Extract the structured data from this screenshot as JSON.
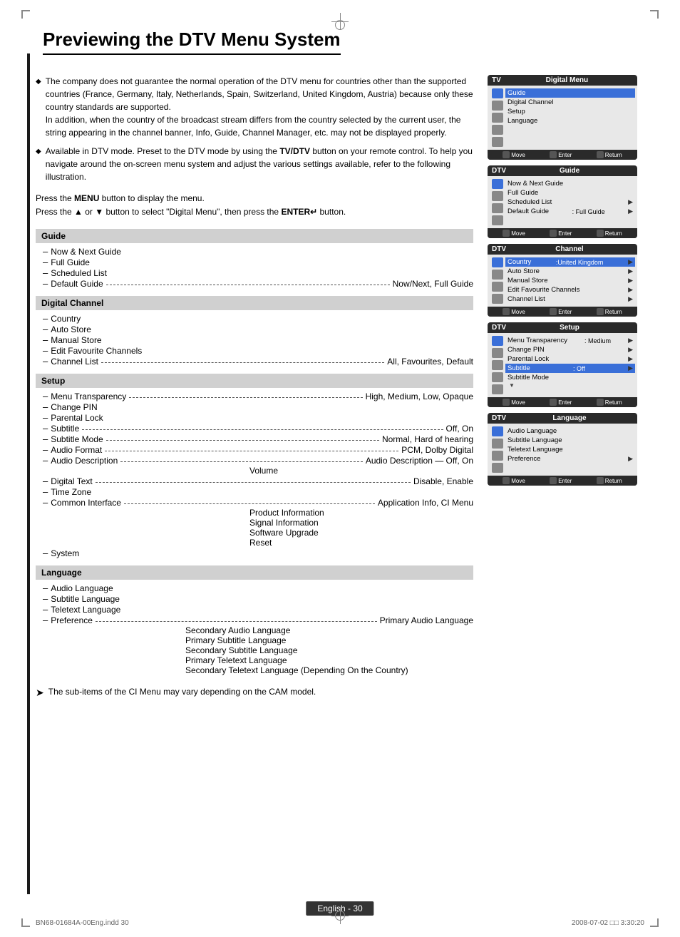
{
  "page": {
    "title": "Previewing the DTV Menu System",
    "crosshair_top": true,
    "crosshair_bottom": true
  },
  "bullets": [
    {
      "id": 1,
      "text": "The company does not guarantee the normal operation of the DTV menu for countries other than the supported countries (France, Germany, Italy, Netherlands, Spain, Switzerland, United Kingdom, Austria) because only these country standards are supported.\nIn addition, when the country of the broadcast stream differs from the country selected by the current user, the string appearing in the channel banner, Info, Guide, Channel Manager, etc. may not be displayed properly."
    },
    {
      "id": 2,
      "text_before": "Available in DTV mode. Preset to the DTV mode by using the ",
      "bold": "TV/DTV",
      "text_after": " button on your remote control. To help you navigate around the on-screen menu system and adjust the various settings available, refer to the following illustration."
    }
  ],
  "press_lines": [
    "Press the MENU button to display the menu.",
    "Press the ▲ or ▼ button to select \"Digital Menu\", then press the ENTER↵ button."
  ],
  "menu_tree": [
    {
      "section": "Guide",
      "items": [
        {
          "label": "Now & Next Guide",
          "annotation": null
        },
        {
          "label": "Full Guide",
          "annotation": null
        },
        {
          "label": "Scheduled List",
          "annotation": null
        },
        {
          "label": "Default Guide",
          "annotation": "Now/Next, Full Guide"
        }
      ]
    },
    {
      "section": "Digital Channel",
      "items": [
        {
          "label": "Country",
          "annotation": null
        },
        {
          "label": "Auto Store",
          "annotation": null
        },
        {
          "label": "Manual Store",
          "annotation": null
        },
        {
          "label": "Edit Favourite Channels",
          "annotation": null
        },
        {
          "label": "Channel List",
          "annotation": "All, Favourites, Default"
        }
      ]
    },
    {
      "section": "Setup",
      "items": [
        {
          "label": "Menu Transparency",
          "annotation": "High, Medium, Low, Opaque"
        },
        {
          "label": "Change PIN",
          "annotation": null
        },
        {
          "label": "Parental Lock",
          "annotation": null
        },
        {
          "label": "Subtitle",
          "annotation": "Off, On"
        },
        {
          "label": "Subtitle Mode",
          "annotation": "Normal, Hard of hearing"
        },
        {
          "label": "Audio Format",
          "annotation": "PCM, Dolby Digital"
        },
        {
          "label": "Audio Description",
          "annotation": "Audio Description — Off, On\nVolume"
        },
        {
          "label": "Digital Text",
          "annotation": "Disable, Enable"
        },
        {
          "label": "Time Zone",
          "annotation": null
        },
        {
          "label": "Common Interface",
          "annotation": "Application Info, CI Menu\nProduct Information\nSignal Information\nSoftware Upgrade\nReset"
        },
        {
          "label": "System",
          "annotation": null
        }
      ]
    },
    {
      "section": "Language",
      "items": [
        {
          "label": "Audio Language",
          "annotation": null
        },
        {
          "label": "Subtitle Language",
          "annotation": null
        },
        {
          "label": "Teletext Language",
          "annotation": null
        },
        {
          "label": "Preference",
          "annotation": "Primary Audio Language\nSecondary Audio Language\nPrimary Subtitle Language\nSecondary Subtitle Language\nPrimary Teletext Language\nSecondary Teletext Language (Depending On the Country)"
        }
      ]
    }
  ],
  "bottom_note": "The sub-items of the CI Menu may vary depending on the CAM model.",
  "footer": {
    "page_label": "English - 30",
    "doc_id": "BN68-01684A-00Eng.indd   30",
    "date": "2008-07-02   □□   3:30:20"
  },
  "tv_panels": [
    {
      "id": "digital-menu",
      "label": "TV",
      "title": "Digital Menu",
      "items": [
        {
          "text": "Guide",
          "highlighted": false
        },
        {
          "text": "Digital Channel",
          "highlighted": false
        },
        {
          "text": "Setup",
          "highlighted": false
        },
        {
          "text": "Language",
          "highlighted": false
        }
      ],
      "has_icons": true,
      "footer_btns": [
        "Move",
        "Enter",
        "Return"
      ]
    },
    {
      "id": "guide",
      "label": "DTV",
      "title": "Guide",
      "items": [
        {
          "text": "Now & Next Guide",
          "highlighted": false
        },
        {
          "text": "Full Guide",
          "highlighted": false
        },
        {
          "text": "Scheduled List",
          "highlighted": false
        },
        {
          "text": "Default Guide",
          "value": ": Full Guide",
          "highlighted": false
        }
      ],
      "has_icons": true,
      "footer_btns": [
        "Move",
        "Enter",
        "Return"
      ]
    },
    {
      "id": "channel",
      "label": "DTV",
      "title": "Channel",
      "items": [
        {
          "text": "Country",
          "value": ":United Kingdom",
          "highlighted": true
        },
        {
          "text": "Auto Store",
          "highlighted": false
        },
        {
          "text": "Manual Store",
          "highlighted": false
        },
        {
          "text": "Edit Favourite Channels",
          "highlighted": false
        },
        {
          "text": "Channel List",
          "highlighted": false
        }
      ],
      "has_icons": true,
      "footer_btns": [
        "Move",
        "Enter",
        "Return"
      ]
    },
    {
      "id": "setup",
      "label": "DTV",
      "title": "Setup",
      "items": [
        {
          "text": "Menu Transparency",
          "value": ": Medium",
          "highlighted": false
        },
        {
          "text": "Change PIN",
          "highlighted": false
        },
        {
          "text": "Parental Lock",
          "highlighted": false
        },
        {
          "text": "Subtitle",
          "value": ": Off",
          "highlighted": true
        },
        {
          "text": "Subtitle Mode",
          "highlighted": false
        }
      ],
      "has_icons": true,
      "footer_btns": [
        "Move",
        "Enter",
        "Return"
      ]
    },
    {
      "id": "language",
      "label": "DTV",
      "title": "Language",
      "items": [
        {
          "text": "Audio Language",
          "highlighted": false
        },
        {
          "text": "Subtitle Language",
          "highlighted": false
        },
        {
          "text": "Teletext Language",
          "highlighted": false
        },
        {
          "text": "Preference",
          "highlighted": false
        }
      ],
      "has_icons": true,
      "footer_btns": [
        "Move",
        "Enter",
        "Return"
      ]
    }
  ]
}
